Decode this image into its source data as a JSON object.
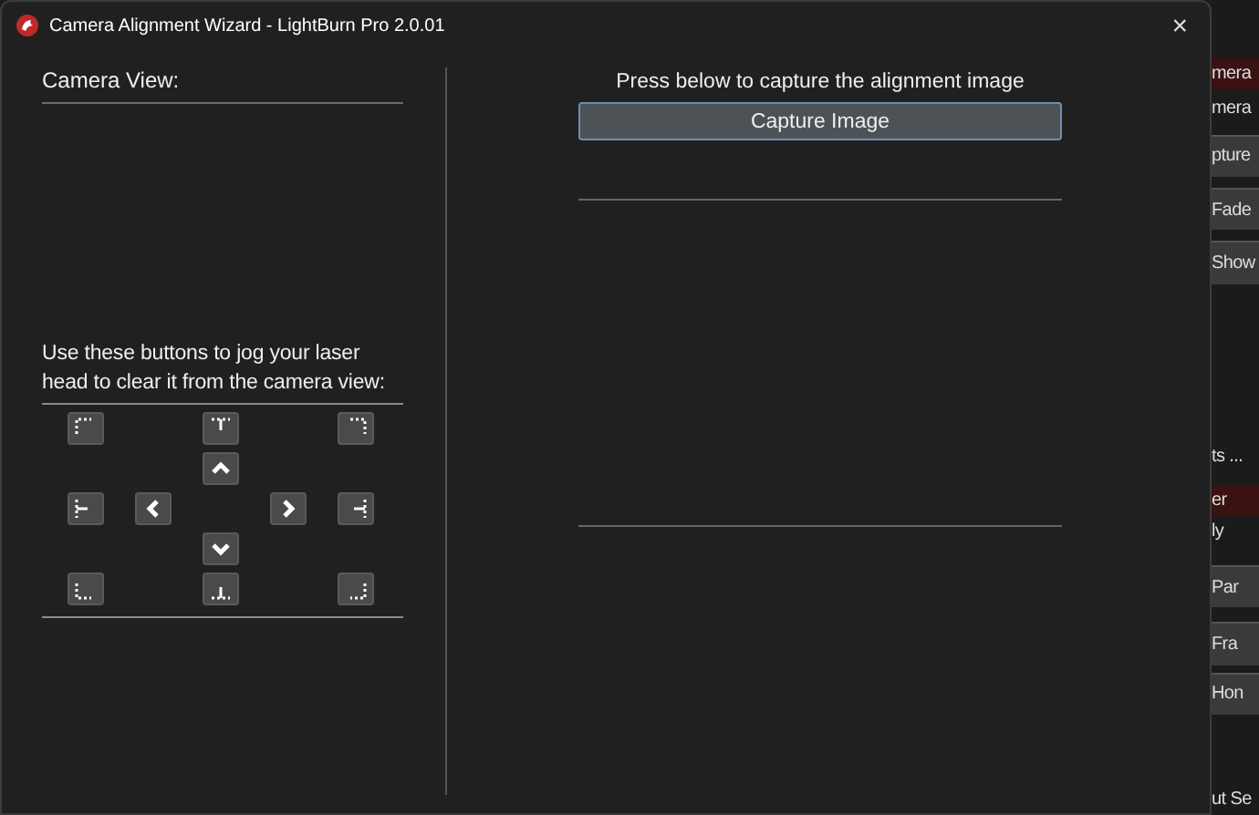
{
  "window": {
    "title": "Camera Alignment Wizard - LightBurn Pro 2.0.01",
    "close": "×"
  },
  "camera_view": {
    "label": "Camera View:"
  },
  "jog": {
    "instructions": "Use these buttons to jog your laser head to clear it from the camera view:",
    "buttons": [
      {
        "kind": "corner-tl"
      },
      {
        "kind": "edge-top"
      },
      {
        "kind": "corner-tr"
      },
      {
        "kind": "up"
      },
      {
        "kind": "edge-left"
      },
      {
        "kind": "left"
      },
      {
        "kind": "right"
      },
      {
        "kind": "edge-right"
      },
      {
        "kind": "down"
      },
      {
        "kind": "corner-bl"
      },
      {
        "kind": "edge-bottom"
      },
      {
        "kind": "corner-br"
      }
    ]
  },
  "capture": {
    "prompt": "Press below to capture the alignment image",
    "button": "Capture Image"
  },
  "background_app": {
    "items": [
      {
        "kind": "header",
        "text": "mera"
      },
      {
        "kind": "text",
        "text": "mera"
      },
      {
        "kind": "button",
        "text": "pture"
      },
      {
        "kind": "button",
        "text": "Fade"
      },
      {
        "kind": "button",
        "text": "Show"
      },
      {
        "kind": "text",
        "text": "ts ..."
      },
      {
        "kind": "header",
        "text": "er"
      },
      {
        "kind": "text",
        "text": "ly"
      },
      {
        "kind": "button",
        "text": "Par"
      },
      {
        "kind": "button",
        "text": "Fra"
      },
      {
        "kind": "button",
        "text": "Hon"
      },
      {
        "kind": "text",
        "text": "ut Se"
      }
    ]
  }
}
